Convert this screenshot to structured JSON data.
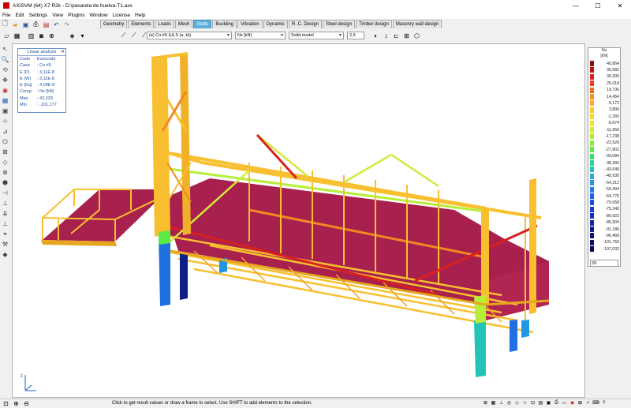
{
  "window": {
    "title": "AXISVM (64) X7 R2k - D:\\pasarela de huelva-T1.axs",
    "minimize": "—",
    "maximize": "☐",
    "close": "✕"
  },
  "menu": [
    "File",
    "Edit",
    "Settings",
    "View",
    "Plugins",
    "Window",
    "License",
    "Help"
  ],
  "tabs": [
    {
      "label": "Geometry"
    },
    {
      "label": "Elements"
    },
    {
      "label": "Loads"
    },
    {
      "label": "Mesh"
    },
    {
      "label": "Static"
    },
    {
      "label": "Buckling"
    },
    {
      "label": "Vibration"
    },
    {
      "label": "Dynamic"
    },
    {
      "label": "R. C. Design"
    },
    {
      "label": "Steel design"
    },
    {
      "label": "Timber design"
    },
    {
      "label": "Masonry wall design"
    }
  ],
  "toolbar2": {
    "load_case": "(e) Co.#6 (ULS (a, b))",
    "component": "Nx [kN]",
    "display_mode": "Solid model",
    "scale": "2,5"
  },
  "info_panel": {
    "header": "Linear analysis",
    "rows": [
      {
        "k": "Code",
        "v": "Eurocode"
      },
      {
        "k": "Case",
        "v": ": Co #6"
      },
      {
        "k": "E (P)",
        "v": ": 3,11E-8"
      },
      {
        "k": "E (W)",
        "v": ": 3,11E-8"
      },
      {
        "k": "E (Eq)",
        "v": ": 4,09E-8"
      },
      {
        "k": "Comp.",
        "v": ": Nx [kN]"
      },
      {
        "k": "Max",
        "v": ": 43,233"
      },
      {
        "k": "Min",
        "v": ": -101,177"
      }
    ]
  },
  "legend": {
    "title": "Nx",
    "unit": "[kN]",
    "entries": [
      {
        "value": "40,864",
        "color": "#8b0f0f"
      },
      {
        "value": "35,582",
        "color": "#b01818"
      },
      {
        "value": "30,300",
        "color": "#d22424"
      },
      {
        "value": "25,018",
        "color": "#e84020"
      },
      {
        "value": "19,736",
        "color": "#f06a20"
      },
      {
        "value": "14,454",
        "color": "#f59028"
      },
      {
        "value": "9,172",
        "color": "#f8ad2c"
      },
      {
        "value": "3,890",
        "color": "#fac832"
      },
      {
        "value": "-1,392",
        "color": "#f5d838"
      },
      {
        "value": "-6,674",
        "color": "#e8e43a"
      },
      {
        "value": "-11,956",
        "color": "#d4ea3a"
      },
      {
        "value": "-17,238",
        "color": "#b6ee3a"
      },
      {
        "value": "-22,520",
        "color": "#8aee3c"
      },
      {
        "value": "-27,802",
        "color": "#5cea44"
      },
      {
        "value": "-33,084",
        "color": "#38e060"
      },
      {
        "value": "-38,366",
        "color": "#2ad290"
      },
      {
        "value": "-43,648",
        "color": "#22c4b8"
      },
      {
        "value": "-48,930",
        "color": "#20b0d6"
      },
      {
        "value": "-54,212",
        "color": "#2096e4"
      },
      {
        "value": "-59,494",
        "color": "#1e7ce8"
      },
      {
        "value": "-64,776",
        "color": "#1c62e6"
      },
      {
        "value": "-70,058",
        "color": "#1a4ce0"
      },
      {
        "value": "-75,340",
        "color": "#183ad4"
      },
      {
        "value": "-80,622",
        "color": "#162cc0"
      },
      {
        "value": "-85,904",
        "color": "#1422a6"
      },
      {
        "value": "-91,186",
        "color": "#111a8c"
      },
      {
        "value": "-96,468",
        "color": "#0e1474"
      },
      {
        "value": "-101,750",
        "color": "#0b0f5e"
      },
      {
        "value": "-107,032",
        "color": "#080a48"
      }
    ],
    "field_value": "29"
  },
  "status": {
    "message": "Click to get result values or draw a frame to select. Use SHIFT to add elements to the selection."
  },
  "colors": {
    "accent": "#5ab0d8",
    "deck": "#a8204e",
    "beam_yellow": "#f8c030",
    "beam_orange": "#f08a20",
    "beam_red": "#d82020",
    "beam_green": "#9ce840",
    "column_blue": "#2070e0",
    "column_navy": "#101e8a"
  }
}
